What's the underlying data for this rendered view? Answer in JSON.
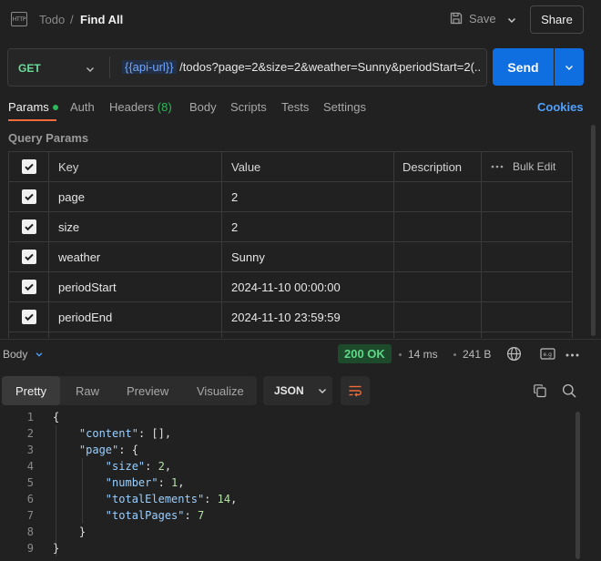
{
  "header": {
    "icon": "HTTP",
    "collection": "Todo",
    "separator": "/",
    "request_name": "Find All",
    "save_label": "Save",
    "share_label": "Share"
  },
  "request": {
    "method": "GET",
    "url_variable": "{{api-url}}",
    "url_path": " /todos?page=2&size=2&weather=Sunny&periodStart=2(...",
    "send_label": "Send"
  },
  "tabs": {
    "params": "Params",
    "auth": "Auth",
    "headers": "Headers",
    "headers_count": "(8)",
    "body": "Body",
    "scripts": "Scripts",
    "tests": "Tests",
    "settings": "Settings",
    "cookies": "Cookies"
  },
  "query_params": {
    "title": "Query Params",
    "columns": {
      "key": "Key",
      "value": "Value",
      "description": "Description",
      "bulk_edit": "Bulk Edit"
    },
    "rows": [
      {
        "key": "page",
        "value": "2",
        "checked": true
      },
      {
        "key": "size",
        "value": "2",
        "checked": true
      },
      {
        "key": "weather",
        "value": "Sunny",
        "checked": true
      },
      {
        "key": "periodStart",
        "value": "2024-11-10 00:00:00",
        "checked": true
      },
      {
        "key": "periodEnd",
        "value": "2024-11-10 23:59:59",
        "checked": true
      }
    ]
  },
  "response": {
    "body_label": "Body",
    "status": "200 OK",
    "time": "14 ms",
    "size": "241 B",
    "view_tabs": [
      "Pretty",
      "Raw",
      "Preview",
      "Visualize"
    ],
    "format": "JSON",
    "line_numbers": [
      "1",
      "2",
      "3",
      "4",
      "5",
      "6",
      "7",
      "8",
      "9"
    ]
  },
  "colors": {
    "accent": "#f26b3a",
    "send": "#0f6ee0",
    "method_get": "#6bdd9a",
    "status_ok": "#5fd887"
  }
}
